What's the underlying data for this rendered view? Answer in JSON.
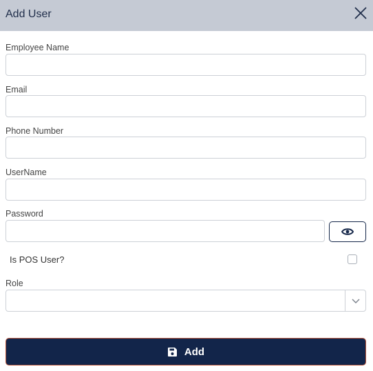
{
  "dialog": {
    "title": "Add User",
    "close_icon": "close-icon"
  },
  "form": {
    "employee_name": {
      "label": "Employee Name",
      "value": ""
    },
    "email": {
      "label": "Email",
      "value": ""
    },
    "phone_number": {
      "label": "Phone Number",
      "value": ""
    },
    "username": {
      "label": "UserName",
      "value": ""
    },
    "password": {
      "label": "Password",
      "value": "",
      "toggle_icon": "eye-icon"
    },
    "is_pos_user": {
      "label": "Is POS User?",
      "checked": false
    },
    "role": {
      "label": "Role",
      "selected": ""
    }
  },
  "actions": {
    "add_label": "Add",
    "add_icon": "save-icon"
  },
  "colors": {
    "header_bg": "#c5cad4",
    "primary": "#12254a",
    "accent_border": "#b8553a"
  }
}
